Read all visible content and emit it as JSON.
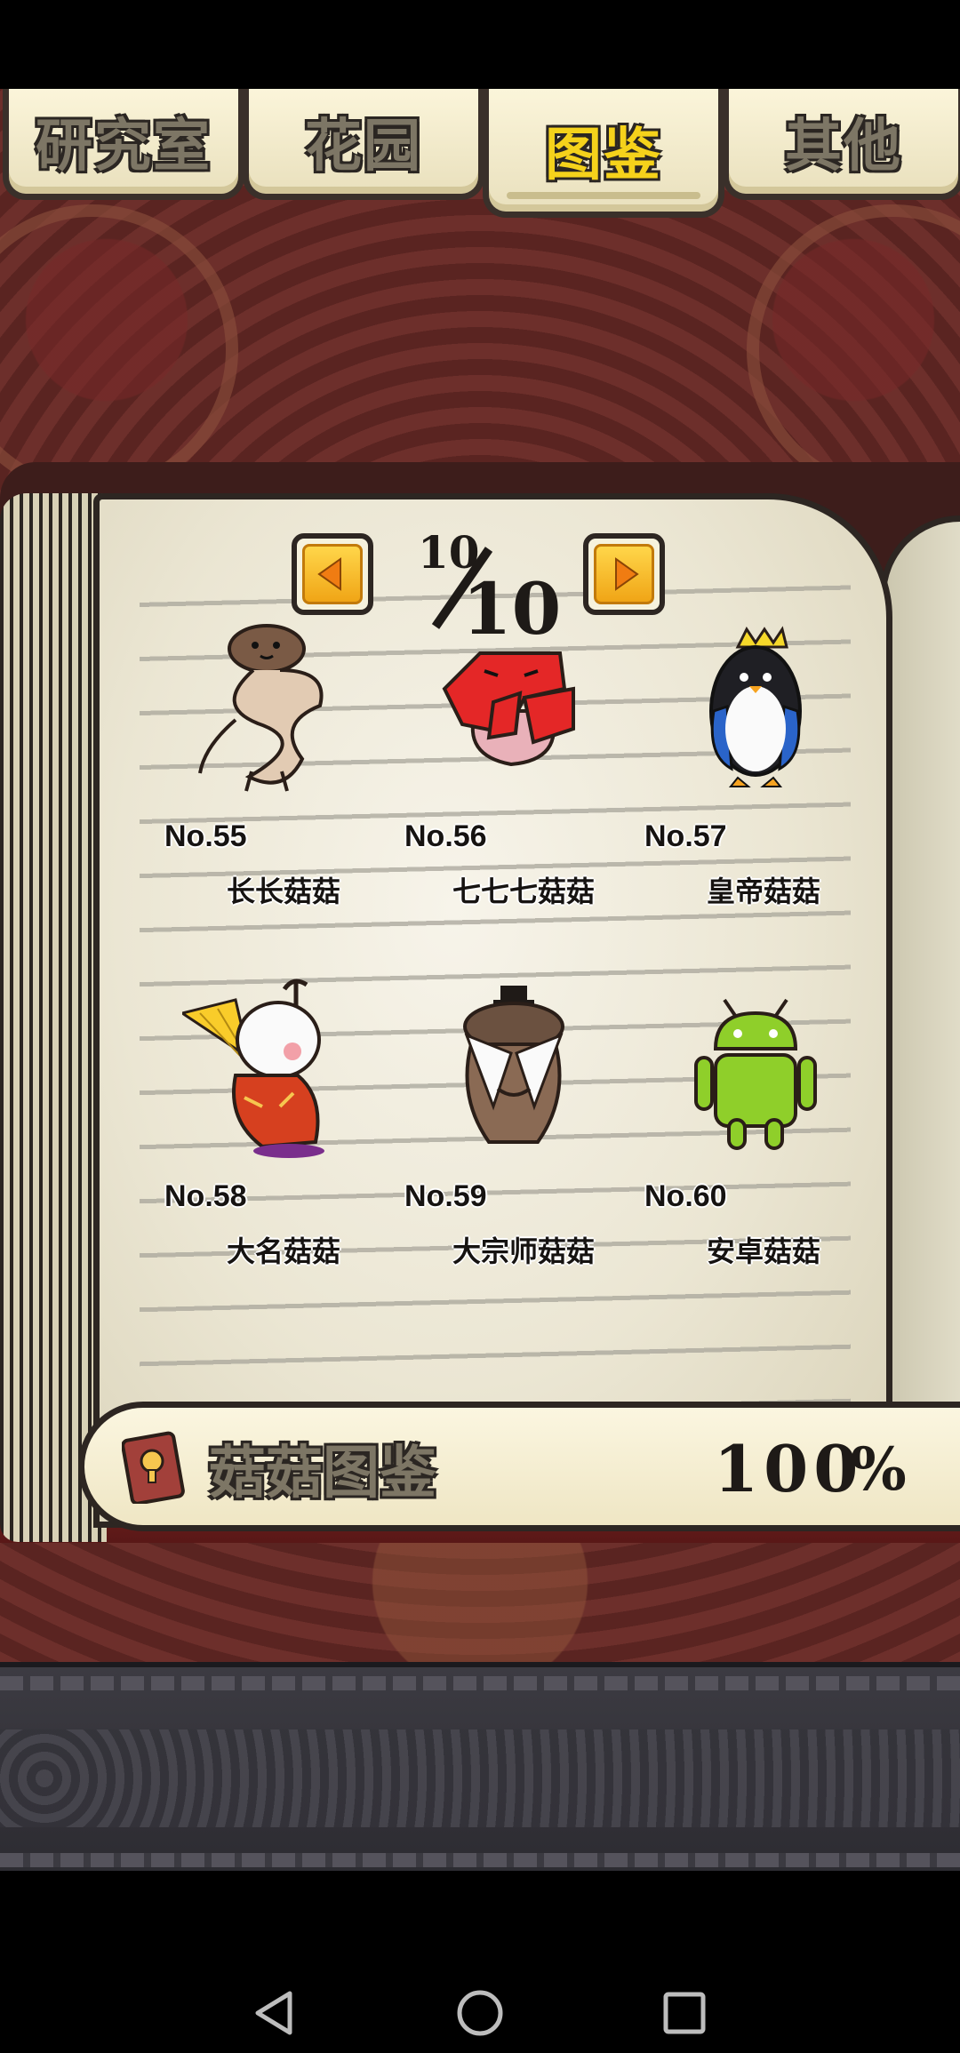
{
  "tabs": [
    {
      "label": "研究室",
      "active": false
    },
    {
      "label": "花园",
      "active": false
    },
    {
      "label": "图鉴",
      "active": true
    },
    {
      "label": "其他",
      "active": false
    }
  ],
  "pager": {
    "current": "10",
    "total": "10"
  },
  "entries": [
    {
      "number": "No.55",
      "name": "长长菇菇",
      "icon": "long-mushroom-icon"
    },
    {
      "number": "No.56",
      "name": "七七七菇菇",
      "icon": "red-777-mushroom-icon"
    },
    {
      "number": "No.57",
      "name": "皇帝菇菇",
      "icon": "emperor-penguin-mushroom-icon"
    },
    {
      "number": "No.58",
      "name": "大名菇菇",
      "icon": "daimyo-mushroom-icon"
    },
    {
      "number": "No.59",
      "name": "大宗师菇菇",
      "icon": "grandmaster-mushroom-icon"
    },
    {
      "number": "No.60",
      "name": "安卓菇菇",
      "icon": "android-mushroom-icon"
    }
  ],
  "completion": {
    "label": "菇菇图鉴",
    "value": "100",
    "unit": "%",
    "progress": 1.0
  },
  "colors": {
    "active_tab_text": "#f5d21b",
    "tab_text": "#7d7665",
    "background": "#6d2f2b",
    "nav_arrow": "#f0a516"
  }
}
